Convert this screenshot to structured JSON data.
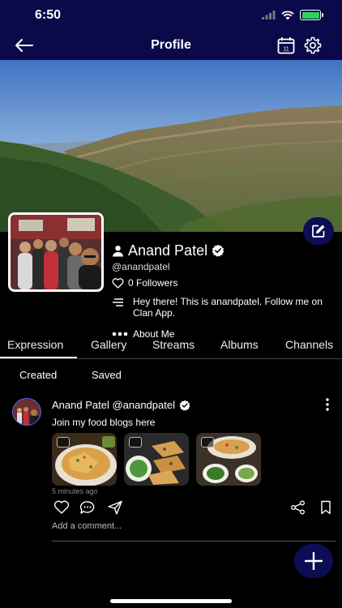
{
  "status_bar": {
    "time": "6:50"
  },
  "nav": {
    "title": "Profile",
    "calendar_day": "11"
  },
  "profile": {
    "name": "Anand Patel",
    "handle": "@anandpatel",
    "followers": "0 Followers",
    "bio": "Hey there! This is anandpatel. Follow me on Clan App.",
    "about": "About Me"
  },
  "tabs": [
    "Expression",
    "Gallery",
    "Streams",
    "Albums",
    "Channels"
  ],
  "subtabs": [
    "Created",
    "Saved"
  ],
  "post": {
    "author": "Anand Patel @anandpatel",
    "text": "Join my food blogs here",
    "time": "5 minutes ago",
    "comment_placeholder": "Add a comment..."
  },
  "colors": {
    "header_bg": "#0a0a4a",
    "fab_bg": "#0d0d55",
    "battery": "#31d158"
  }
}
